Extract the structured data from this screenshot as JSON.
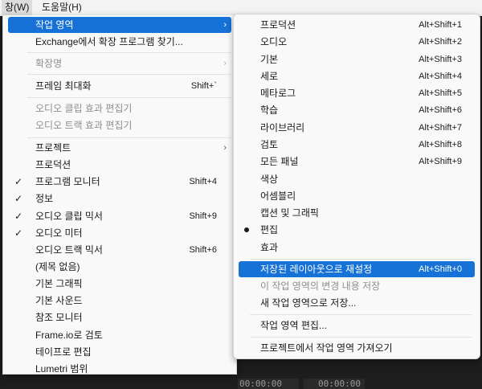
{
  "menubar": {
    "window": "창(W)",
    "help": "도움말(H)"
  },
  "background": {
    "timecode_1": "00:00:00",
    "timecode_2": "00:00:00"
  },
  "main_menu": {
    "workspace": "작업 영역",
    "exchange": "Exchange에서 확장 프로그램 찾기...",
    "extensions": "확장명",
    "maximize_frame": "프레임 최대화",
    "maximize_frame_shortcut": "Shift+`",
    "audio_clip_effect_editor": "오디오 클립 효과 편집기",
    "audio_track_effect_editor": "오디오 트랙 효과 편집기",
    "project": "프로젝트",
    "production": "프로덕션",
    "program_monitor": "프로그램 모니터",
    "program_monitor_shortcut": "Shift+4",
    "info": "정보",
    "audio_clip_mixer": "오디오 클립 믹서",
    "audio_clip_mixer_shortcut": "Shift+9",
    "audio_meters": "오디오 미터",
    "audio_track_mixer": "오디오 트랙 믹서",
    "audio_track_mixer_shortcut": "Shift+6",
    "untitled": "(제목 없음)",
    "essential_graphics": "기본 그래픽",
    "essential_sound": "기본 사운드",
    "reference_monitor": "참조 모니터",
    "frameio_review": "Frame.io로 검토",
    "text_edit": "테이프로 편집",
    "lumetri": "Lumetri 범위"
  },
  "submenu": {
    "production": "프로덕션",
    "production_sc": "Alt+Shift+1",
    "audio": "오디오",
    "audio_sc": "Alt+Shift+2",
    "basic": "기본",
    "basic_sc": "Alt+Shift+3",
    "vertical": "세로",
    "vertical_sc": "Alt+Shift+4",
    "metalogging": "메타로그",
    "metalogging_sc": "Alt+Shift+5",
    "learning": "학습",
    "learning_sc": "Alt+Shift+6",
    "libraries": "라이브러리",
    "libraries_sc": "Alt+Shift+7",
    "review": "검토",
    "review_sc": "Alt+Shift+8",
    "all_panels": "모든 패널",
    "all_panels_sc": "Alt+Shift+9",
    "color": "색상",
    "assembly": "어셈블리",
    "captions": "캡션 및 그래픽",
    "editing": "편집",
    "effects": "효과",
    "reset": "저장된 레이아웃으로 재설정",
    "reset_sc": "Alt+Shift+0",
    "save_changes": "이 작업 영역의 변경 내용 저장",
    "save_new": "새 작업 영역으로 저장...",
    "edit_workspaces": "작업 영역 편집...",
    "import_from_project": "프로젝트에서 작업 영역 가져오기"
  }
}
